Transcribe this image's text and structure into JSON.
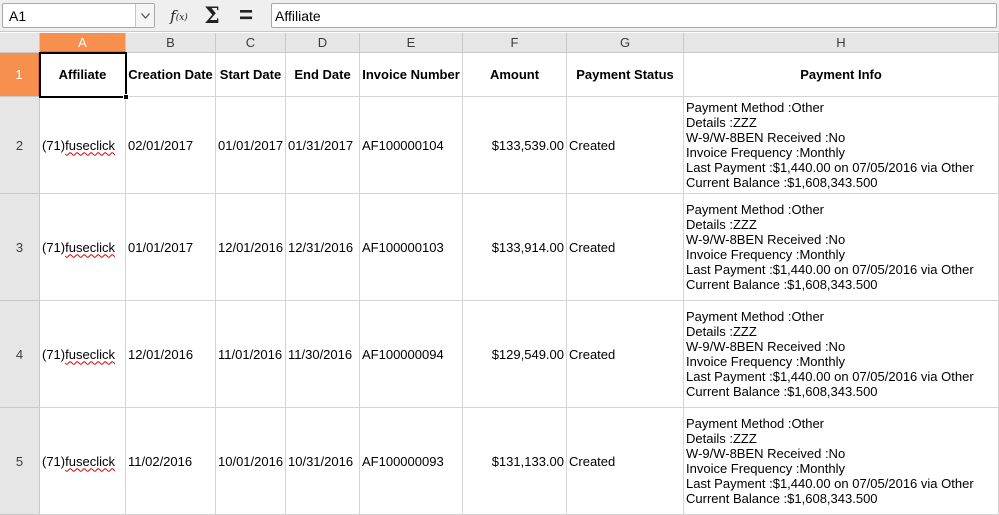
{
  "formula_bar": {
    "name_box": "A1",
    "function_wizard_icon": "fx-icon",
    "sum_icon": "sigma-icon",
    "formula_icon": "equals-icon",
    "formula_content": "Affiliate"
  },
  "sheet": {
    "columns": [
      "A",
      "B",
      "C",
      "D",
      "E",
      "F",
      "G",
      "H"
    ],
    "selected_column": "A",
    "rows": [
      "1",
      "2",
      "3",
      "4",
      "5"
    ],
    "selected_row": "1",
    "header_row": [
      "Affiliate",
      "Creation Date",
      "Start Date",
      "End Date",
      "Invoice Number",
      "Amount",
      "Payment Status",
      "Payment Info"
    ],
    "records": [
      {
        "affiliate_prefix": "(71)",
        "affiliate_name": "fuseclick",
        "creation_date": "02/01/2017",
        "start_date": "01/01/2017",
        "end_date": "01/31/2017",
        "invoice_number": "AF100000104",
        "amount": "$133,539.00",
        "payment_status": "Created",
        "payment_info": [
          "Payment Method :Other",
          "Details :ZZZ",
          "W-9/W-8BEN Received :No",
          "Invoice Frequency :Monthly",
          "Last Payment :$1,440.00 on 07/05/2016 via Other",
          "Current Balance :$1,608,343.500"
        ]
      },
      {
        "affiliate_prefix": "(71)",
        "affiliate_name": "fuseclick",
        "creation_date": "01/01/2017",
        "start_date": "12/01/2016",
        "end_date": "12/31/2016",
        "invoice_number": "AF100000103",
        "amount": "$133,914.00",
        "payment_status": "Created",
        "payment_info": [
          "Payment Method :Other",
          "Details :ZZZ",
          "W-9/W-8BEN Received :No",
          "Invoice Frequency :Monthly",
          "Last Payment :$1,440.00 on 07/05/2016 via Other",
          "Current Balance :$1,608,343.500"
        ]
      },
      {
        "affiliate_prefix": "(71)",
        "affiliate_name": "fuseclick",
        "creation_date": "12/01/2016",
        "start_date": "11/01/2016",
        "end_date": "11/30/2016",
        "invoice_number": "AF100000094",
        "amount": "$129,549.00",
        "payment_status": "Created",
        "payment_info": [
          "Payment Method :Other",
          "Details :ZZZ",
          "W-9/W-8BEN Received :No",
          "Invoice Frequency :Monthly",
          "Last Payment :$1,440.00 on 07/05/2016 via Other",
          "Current Balance :$1,608,343.500"
        ]
      },
      {
        "affiliate_prefix": "(71)",
        "affiliate_name": "fuseclick",
        "creation_date": "11/02/2016",
        "start_date": "10/01/2016",
        "end_date": "10/31/2016",
        "invoice_number": "AF100000093",
        "amount": "$131,133.00",
        "payment_status": "Created",
        "payment_info": [
          "Payment Method :Other",
          "Details :ZZZ",
          "W-9/W-8BEN Received :No",
          "Invoice Frequency :Monthly",
          "Last Payment :$1,440.00 on 07/05/2016 via Other",
          "Current Balance :$1,608,343.500"
        ]
      }
    ]
  },
  "colors": {
    "selection_header": "#f7904f",
    "header_bg": "#e6e6e6",
    "spellcheck_underline": "#d00000"
  }
}
